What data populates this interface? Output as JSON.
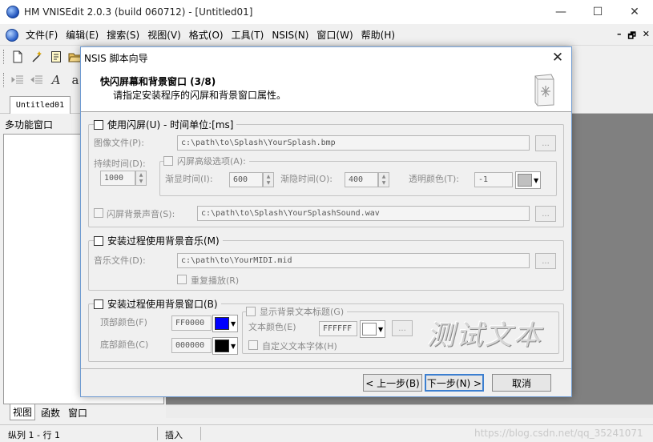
{
  "app": {
    "title": "HM VNISEdit 2.0.3 (build 060712) - [Untitled01]",
    "window_controls": [
      "—",
      "☐",
      "✕"
    ]
  },
  "menu": {
    "items": [
      "文件(F)",
      "编辑(E)",
      "搜索(S)",
      "视图(V)",
      "格式(O)",
      "工具(T)",
      "NSIS(N)",
      "窗口(W)",
      "帮助(H)"
    ],
    "mdi_controls": [
      "–",
      "🗗",
      "✕"
    ]
  },
  "toolbar": {
    "row2_letters": [
      "A",
      "a"
    ]
  },
  "document_tab": "Untitled01",
  "side_panel": {
    "title": "多功能窗口",
    "tabs": [
      "视图",
      "函数",
      "窗口"
    ]
  },
  "statusbar": {
    "position": "纵列 1 - 行 1",
    "mode": "插入",
    "watermark": "https://blog.csdn.net/qq_35241071"
  },
  "dialog": {
    "title": "NSIS 脚本向导",
    "close": "✕",
    "header_title": "快闪屏幕和背景窗口 (3/8)",
    "header_subtitle": "请指定安装程序的闪屏和背景窗口属性。",
    "splash": {
      "checkbox_label": "使用闪屏(U) - 时间单位:[ms]",
      "image_label": "图像文件(P):",
      "image_path": "c:\\path\\to\\Splash\\YourSplash.bmp",
      "duration_label": "持续时间(D):",
      "duration_value": "1000",
      "advanced_label": "闪屏高级选项(A):",
      "fadein_label": "渐显时间(I):",
      "fadein_value": "600",
      "fadeout_label": "渐隐时间(O):",
      "fadeout_value": "400",
      "transparent_label": "透明颜色(T):",
      "transparent_value": "-1",
      "sound_label": "闪屏背景声音(S):",
      "sound_path": "c:\\path\\to\\Splash\\YourSplashSound.wav",
      "browse": "..."
    },
    "music": {
      "checkbox_label": "安装过程使用背景音乐(M)",
      "file_label": "音乐文件(D):",
      "file_path": "c:\\path\\to\\YourMIDI.mid",
      "repeat_label": "重复播放(R)",
      "browse": "..."
    },
    "background": {
      "checkbox_label": "安装过程使用背景窗口(B)",
      "top_color_label": "顶部颜色(F)",
      "top_color_value": "FF0000",
      "top_color_swatch": "#0000ff",
      "bottom_color_label": "底部颜色(C)",
      "bottom_color_value": "000000",
      "bottom_color_swatch": "#000000",
      "show_title_label": "显示背景文本标题(G)",
      "text_color_label": "文本颜色(E)",
      "text_color_value": "FFFFFF",
      "text_color_swatch": "#ffffff",
      "custom_font_label": "自定义文本字体(H)",
      "preview_text": "测试文本",
      "browse": "..."
    },
    "buttons": {
      "back": "< 上一步(B)",
      "next": "下一步(N) >",
      "cancel": "取消"
    }
  }
}
